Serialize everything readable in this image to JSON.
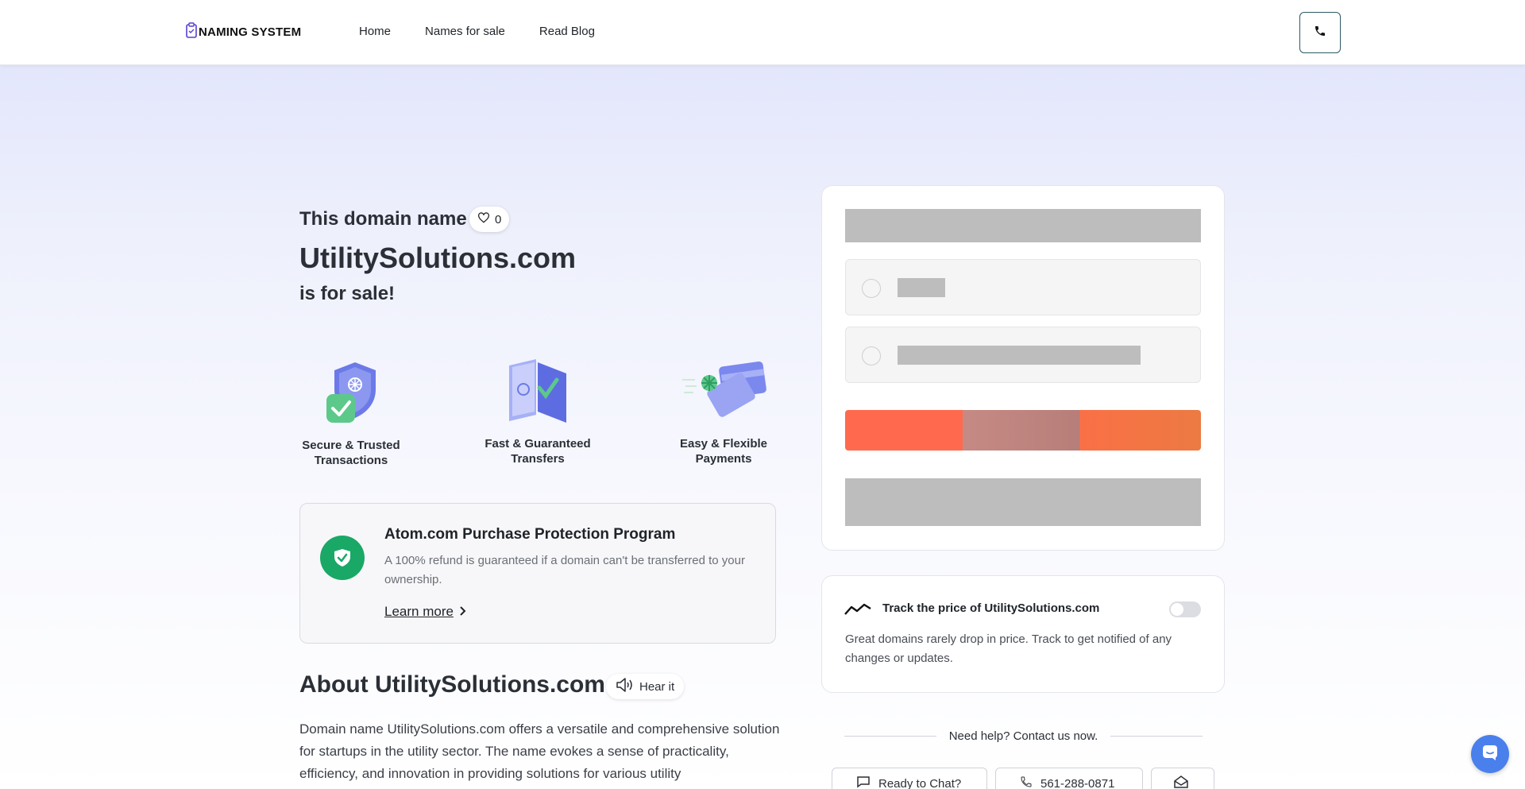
{
  "header": {
    "logo_text": "NAMING SYSTEM",
    "nav": [
      "Home",
      "Names for sale",
      "Read Blog"
    ]
  },
  "hero": {
    "line1": "This domain name",
    "likes": "0",
    "domain": "UtilitySolutions.com",
    "line3": "is for sale!"
  },
  "features": [
    {
      "label": "Secure & Trusted Transactions",
      "icon": "shield-check-icon"
    },
    {
      "label": "Fast & Guaranteed Transfers",
      "icon": "transfer-folders-icon"
    },
    {
      "label": "Easy & Flexible Payments",
      "icon": "payment-cards-icon"
    }
  ],
  "protection": {
    "title": "Atom.com Purchase Protection Program",
    "description": "A 100% refund is guaranteed if a domain can't be transferred to your ownership.",
    "learn_more": "Learn more"
  },
  "about": {
    "title": "About UtilitySolutions.com",
    "hear_it": "Hear it",
    "text": "Domain name UtilitySolutions.com offers a versatile and comprehensive solution for startups in the utility sector. The name evokes a sense of practicality, efficiency, and innovation in providing solutions for various utility"
  },
  "track": {
    "title": "Track the price of UtilitySolutions.com",
    "description": "Great domains rarely drop in price. Track to get notified of any changes or updates.",
    "enabled": false
  },
  "help": {
    "text": "Need help? Contact us now.",
    "chat_label": "Ready to Chat?",
    "phone_label": "561-288-0871"
  },
  "colors": {
    "accent_orange": "#ff6a4e",
    "success_green": "#1aa866",
    "chat_blue": "#4a80ec"
  }
}
